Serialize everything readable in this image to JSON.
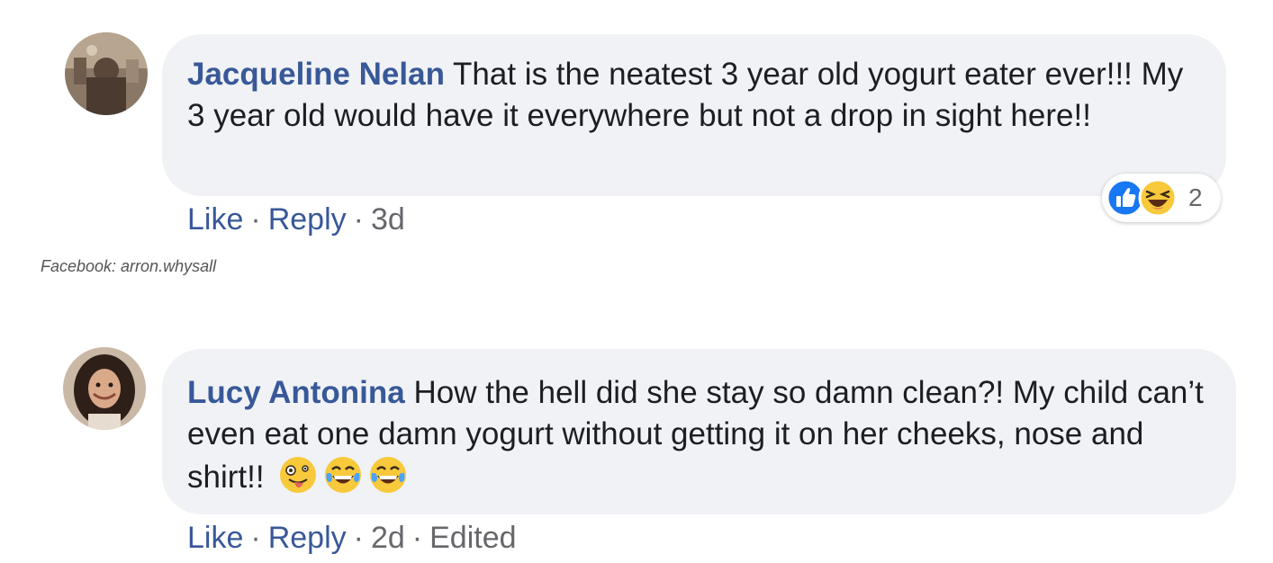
{
  "comments": [
    {
      "author": "Jacqueline Nelan",
      "text": "That is the neatest 3 year old yogurt eater ever!!! My 3 year old would have it everywhere but not a drop in sight here!!",
      "actions": {
        "like": "Like",
        "reply": "Reply",
        "time": "3d"
      },
      "reactions": {
        "icons": [
          "like-icon",
          "haha-icon"
        ],
        "count": "2"
      }
    },
    {
      "author": "Lucy Antonina",
      "text": "How the hell did she stay so damn clean?! My child can’t even eat one damn yogurt without getting it on her cheeks, nose and shirt!!",
      "emojis": [
        "zany-face-icon",
        "tears-of-joy-icon",
        "tears-of-joy-icon"
      ],
      "actions": {
        "like": "Like",
        "reply": "Reply",
        "time": "2d",
        "edited": "Edited"
      }
    }
  ],
  "credit": "Facebook: arron.whysall",
  "colors": {
    "bubble": "#f0f2f5",
    "author": "#385898",
    "meta": "#65676b",
    "like_blue": "#1877f2",
    "emoji_yellow": "#f7c93b"
  }
}
